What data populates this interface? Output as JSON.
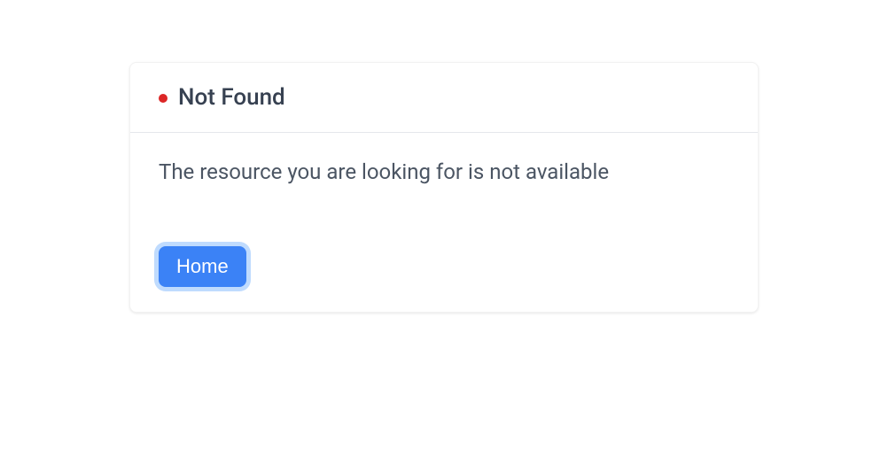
{
  "card": {
    "status_color": "#dc2626",
    "title": "Not Found",
    "message": "The resource you are looking for is not available",
    "home_button_label": "Home"
  }
}
